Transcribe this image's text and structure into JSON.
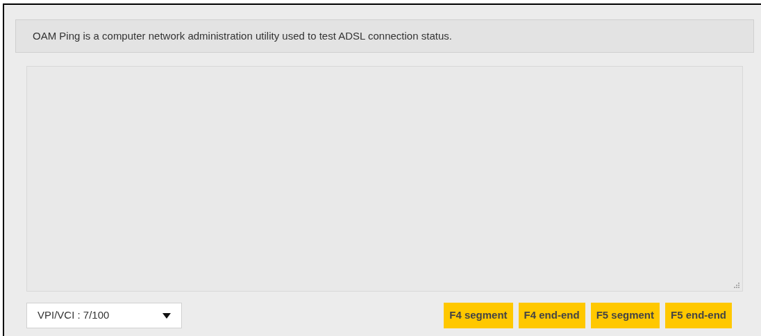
{
  "description": "OAM Ping is a computer network administration utility used to test ADSL connection status.",
  "output": {
    "resize_grip": true
  },
  "vpi_vci": {
    "value": "VPI/VCI : 7/100"
  },
  "buttons": [
    "F4 segment",
    "F4 end-end",
    "F5 segment",
    "F5 end-end"
  ]
}
